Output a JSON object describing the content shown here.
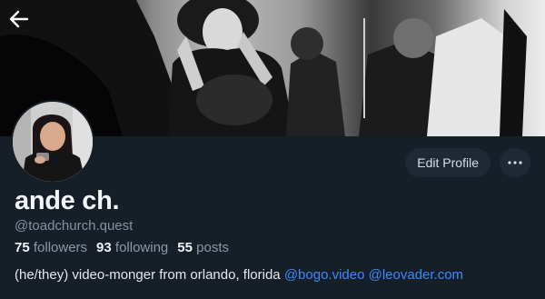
{
  "header": {
    "back_icon": "arrow-left-icon"
  },
  "profile": {
    "display_name": "ande ch.",
    "handle": "@toadchurch.quest",
    "edit_label": "Edit Profile",
    "more_icon": "ellipsis-icon",
    "stats": {
      "followers_count": "75",
      "followers_label": "followers",
      "following_count": "93",
      "following_label": "following",
      "posts_count": "55",
      "posts_label": "posts"
    },
    "bio": {
      "text": "(he/they) video-monger from orlando, florida",
      "link1": "@bogo.video",
      "link2": "@leovader.com"
    }
  },
  "colors": {
    "background": "#161e27",
    "link": "#3b8cff",
    "button_bg": "#1e2935"
  }
}
